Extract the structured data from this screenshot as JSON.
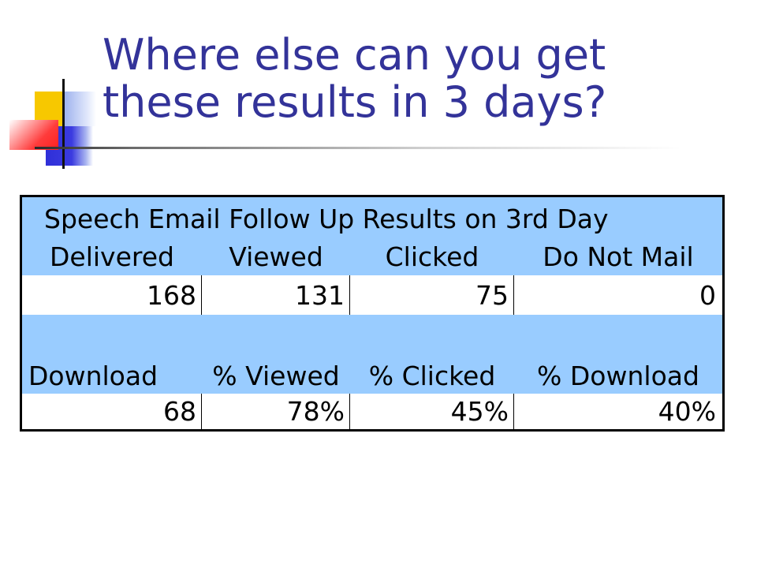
{
  "slide": {
    "title": "Where else can you get these results in 3 days?"
  },
  "table": {
    "caption": "Speech Email Follow Up Results on 3rd Day",
    "header_row_1": [
      "Delivered",
      "Viewed",
      "Clicked",
      "Do Not Mail"
    ],
    "value_row_1": [
      "168",
      "131",
      "75",
      "0"
    ],
    "header_row_2": [
      "Download",
      "% Viewed",
      "% Clicked",
      "% Download"
    ],
    "value_row_2": [
      "68",
      "78%",
      "45%",
      "40%"
    ],
    "header_color": "#99ccff"
  },
  "colors": {
    "title": "#333399",
    "accent_yellow": "#f7c800",
    "accent_blue": "#2f2fd8",
    "accent_red": "#ff3b3b"
  }
}
